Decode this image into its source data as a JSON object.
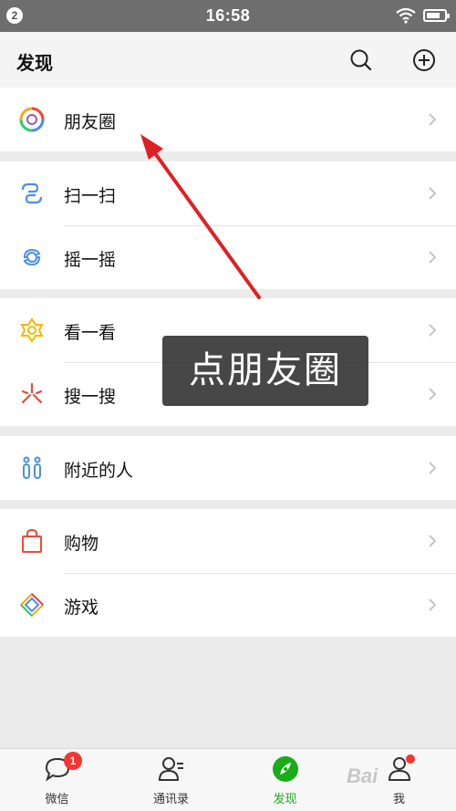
{
  "status_bar": {
    "notification_count": "2",
    "time": "16:58"
  },
  "nav": {
    "title": "发现",
    "search_icon": "search-icon",
    "add_icon": "plus-circle-icon"
  },
  "groups": [
    {
      "items": [
        {
          "label": "朋友圈",
          "icon": "moments-icon"
        }
      ]
    },
    {
      "items": [
        {
          "label": "扫一扫",
          "icon": "scan-icon"
        },
        {
          "label": "摇一摇",
          "icon": "shake-icon"
        }
      ]
    },
    {
      "items": [
        {
          "label": "看一看",
          "icon": "top-stories-icon"
        },
        {
          "label": "搜一搜",
          "icon": "search-explore-icon"
        }
      ]
    },
    {
      "items": [
        {
          "label": "附近的人",
          "icon": "people-nearby-icon"
        }
      ]
    },
    {
      "items": [
        {
          "label": "购物",
          "icon": "shopping-bag-icon"
        },
        {
          "label": "游戏",
          "icon": "games-icon"
        }
      ]
    }
  ],
  "annotation": {
    "text": "点朋友圈"
  },
  "tabs": [
    {
      "label": "微信",
      "icon": "chat-bubble-icon",
      "badge": "1"
    },
    {
      "label": "通讯录",
      "icon": "contacts-icon"
    },
    {
      "label": "发现",
      "icon": "compass-icon",
      "active": true
    },
    {
      "label": "我",
      "icon": "profile-icon",
      "dot": true
    }
  ],
  "watermark": "Bai",
  "colors": {
    "accent": "#1aad19",
    "badge": "#f43530",
    "arrow": "#e02020"
  }
}
